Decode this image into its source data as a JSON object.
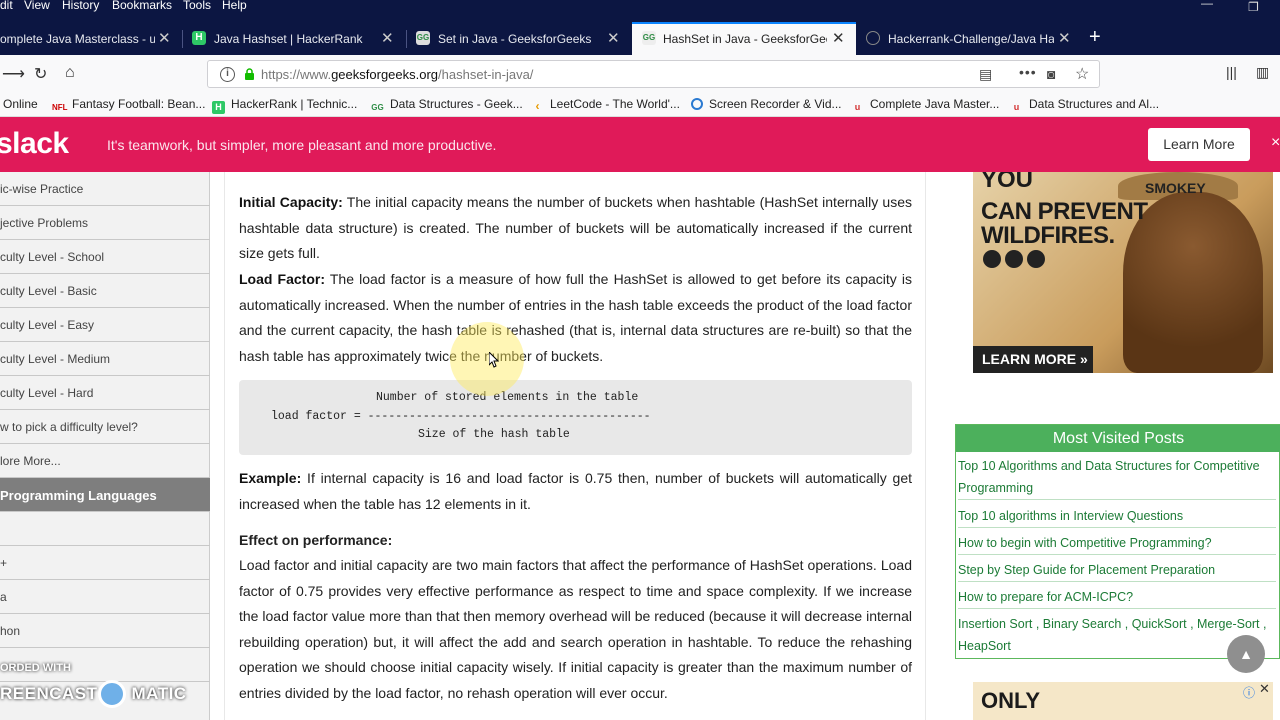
{
  "menu": [
    "dit",
    "View",
    "History",
    "Bookmarks",
    "Tools",
    "Help"
  ],
  "tabs": [
    {
      "label": "omplete Java Masterclass - up",
      "icon": "udemy-icon",
      "active": false
    },
    {
      "label": "Java Hashset | HackerRank",
      "icon": "hackerrank-icon",
      "active": false
    },
    {
      "label": "Set in Java - GeeksforGeeks",
      "icon": "gfg-icon",
      "active": false
    },
    {
      "label": "HashSet in Java - GeeksforGee",
      "icon": "gfg-icon",
      "active": true
    },
    {
      "label": "Hackerrank-Challenge/Java Ha",
      "icon": "github-icon",
      "active": false
    }
  ],
  "url": {
    "prefix": "https://www.",
    "host": "geeksforgeeks.org",
    "path": "/hashset-in-java/"
  },
  "bookmarks": [
    "Online",
    "Fantasy Football: Bean...",
    "HackerRank | Technic...",
    "Data Structures - Geek...",
    "LeetCode - The World'...",
    "Screen Recorder & Vid...",
    "Complete Java Master...",
    "Data Structures and Al..."
  ],
  "slack": {
    "logo": "slack",
    "message": "It's teamwork, but simpler, more pleasant and more productive.",
    "button": "Learn More",
    "close": "×"
  },
  "sidebar": [
    "ic-wise Practice",
    "jective Problems",
    "culty Level - School",
    "culty Level - Basic",
    "culty Level - Easy",
    "culty Level - Medium",
    "culty Level - Hard",
    "w to pick a difficulty level?",
    "lore More...",
    "Programming Languages",
    "",
    "+",
    "a",
    "hon"
  ],
  "article": {
    "p1_title": "Initial Capacity:",
    "p1_text": " The initial capacity means the number of buckets when hashtable (HashSet internally uses hashtable data structure) is created. The number of buckets will be automatically increased if the current size gets full.",
    "p2_title": "Load Factor:",
    "p2_text": " The load factor is a measure of how full the HashSet is allowed to get before its capacity is automatically increased. When the number of entries in the hash table exceeds the product of the load factor and the current capacity, the hash table is rehashed (that is, internal data structures are re-built) so that the hash table has approximately twice the number of buckets.",
    "code": [
      "Number of stored elements in the table",
      "load factor = -----------------------------------------",
      "Size of the hash table"
    ],
    "p3_title": "Example:",
    "p3_text": " If internal capacity is 16 and load factor is 0.75 then, number of buckets will automatically get increased when the table has 12 elements in it.",
    "h_perf": "Effect on performance:",
    "p4_text": "Load factor and initial capacity are two main factors that affect the performance of HashSet operations. Load factor of 0.75 provides very effective performance as respect to time and space complexity. If we increase the load factor value more than that then memory overhead will be reduced (because it will decrease internal rebuilding operation) but, it will affect the add and search operation in hashtable. To reduce the rehashing operation we should choose initial capacity wisely. If initial capacity is greater than the maximum number of entries divided by the load factor, no rehash operation will ever occur."
  },
  "ad1": {
    "top": "YOU",
    "line1": "CAN PREVENT",
    "line2": "WILDFIRES.",
    "smokey": "SMOKEY",
    "learn": "LEARN MORE »"
  },
  "posts": {
    "title": "Most Visited Posts",
    "items": [
      "Top 10 Algorithms and Data Structures for Competitive Programming",
      "Top 10 algorithms in Interview Questions",
      "How to begin with Competitive Programming?",
      "Step by Step Guide for Placement Preparation",
      "How to prepare for ACM-ICPC?"
    ],
    "tags": [
      "Insertion Sort",
      "Binary Search",
      "QuickSort",
      "Merge-Sort",
      "HeapSort"
    ]
  },
  "ad2": {
    "text": "ONLY"
  },
  "watermark": {
    "recorded": "ORDED WITH",
    "brand": "REENCAST",
    "brand2": "MATIC"
  },
  "scroll_top": "▲"
}
